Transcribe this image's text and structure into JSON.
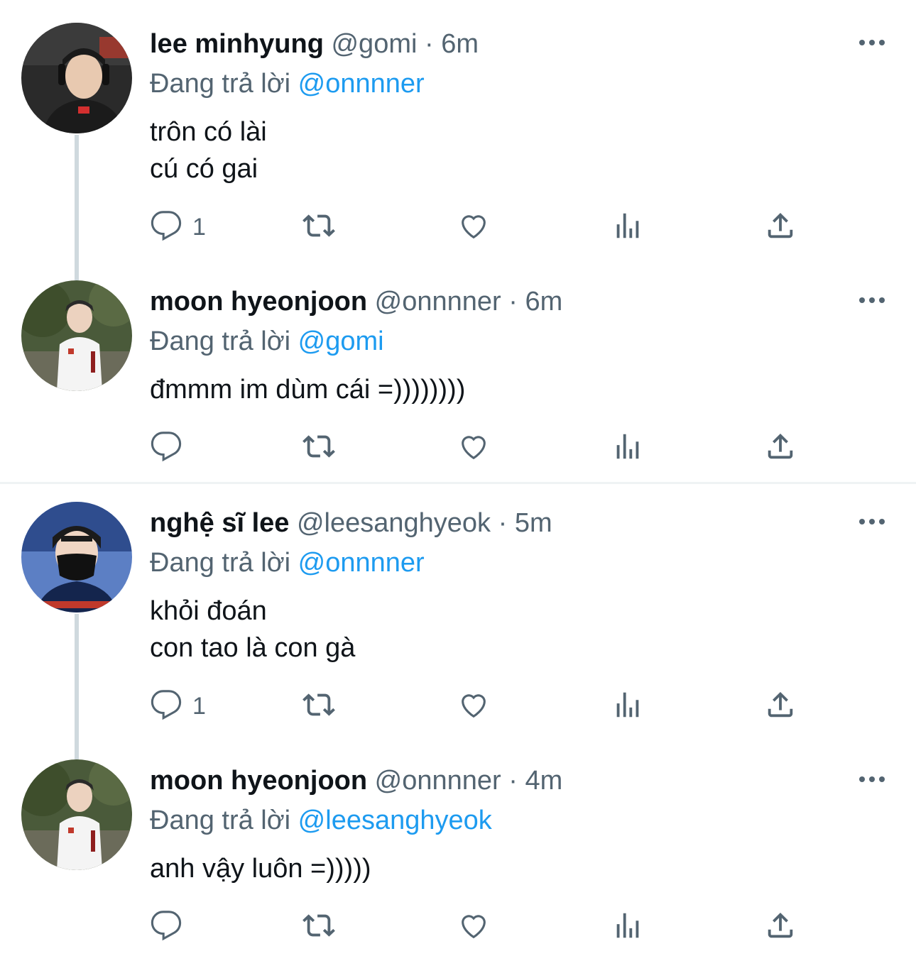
{
  "colors": {
    "link": "#1d9bf0",
    "muted": "#536471",
    "text": "#0f1419",
    "thread_line": "#cfd9de"
  },
  "tweets": [
    {
      "name": "lee minhyung",
      "handle": "@gomi",
      "separator": "·",
      "time": "6m",
      "replying_prefix": "Đang trả lời",
      "replying_to": "@onnnner",
      "lines": [
        "trôn có lài",
        "cú có gai"
      ],
      "reply_count": "1",
      "avatar": "avatar-headset-player"
    },
    {
      "name": "moon hyeonjoon",
      "handle": "@onnnner",
      "separator": "·",
      "time": "6m",
      "replying_prefix": "Đang trả lời",
      "replying_to": "@gomi",
      "lines": [
        "đmmm im dùm cái =))))))))"
      ],
      "reply_count": "",
      "avatar": "avatar-white-jacket-player"
    },
    {
      "name": "nghệ sĩ lee",
      "handle": "@leesanghyeok",
      "separator": "·",
      "time": "5m",
      "replying_prefix": "Đang trả lời",
      "replying_to": "@onnnner",
      "lines": [
        "khỏi đoán",
        "con tao là con gà"
      ],
      "reply_count": "1",
      "avatar": "avatar-masked-player"
    },
    {
      "name": "moon hyeonjoon",
      "handle": "@onnnner",
      "separator": "·",
      "time": "4m",
      "replying_prefix": "Đang trả lời",
      "replying_to": "@leesanghyeok",
      "lines": [
        "anh vậy luôn =)))))"
      ],
      "reply_count": "",
      "avatar": "avatar-white-jacket-player"
    }
  ],
  "icons": {
    "reply": "reply-icon",
    "retweet": "retweet-icon",
    "like": "heart-icon",
    "views": "analytics-icon",
    "share": "share-icon",
    "more": "more-dots-icon"
  }
}
